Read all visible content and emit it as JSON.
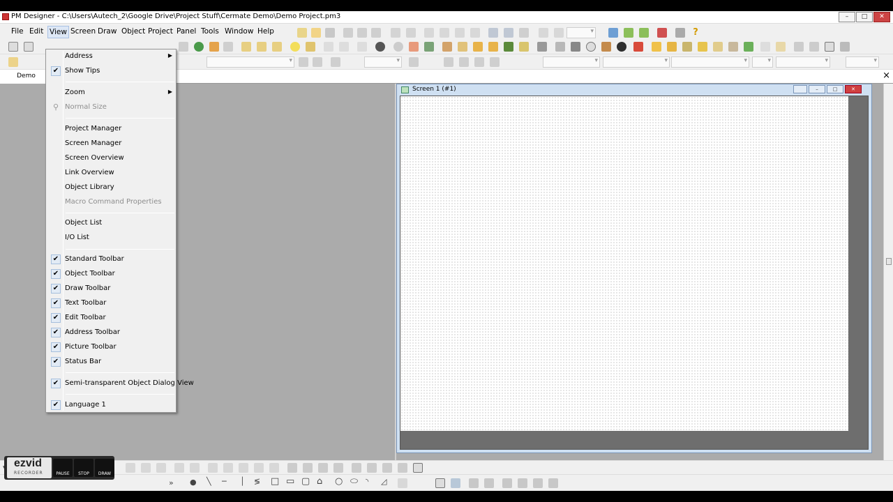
{
  "window": {
    "title": "PM Designer - C:\\Users\\Autech_2\\Google Drive\\Project Stuff\\Cermate Demo\\Demo Project.pm3",
    "min": "–",
    "max": "□",
    "close": "✕"
  },
  "menubar": {
    "items": [
      "File",
      "Edit",
      "View",
      "Screen",
      "Draw",
      "Object",
      "Project",
      "Panel",
      "Tools",
      "Window",
      "Help"
    ],
    "active_index": 2
  },
  "tabs": {
    "project_tab": "Demo",
    "close": "×"
  },
  "view_menu": {
    "items": [
      {
        "label": "Address",
        "submenu": true
      },
      {
        "label": "Show Tips",
        "checked": true
      },
      {
        "label": "Zoom",
        "submenu": true
      },
      {
        "label": "Normal Size",
        "disabled": true,
        "icon": "magnifier-icon"
      },
      {
        "label": "Project Manager"
      },
      {
        "label": "Screen Manager"
      },
      {
        "label": "Screen Overview"
      },
      {
        "label": "Link Overview"
      },
      {
        "label": "Object Library"
      },
      {
        "label": "Macro Command Properties",
        "disabled": true
      },
      {
        "label": "Object List"
      },
      {
        "label": "I/O List"
      },
      {
        "label": "Standard Toolbar",
        "checked": true
      },
      {
        "label": "Object Toolbar",
        "checked": true
      },
      {
        "label": "Draw Toolbar",
        "checked": true
      },
      {
        "label": "Text Toolbar",
        "checked": true
      },
      {
        "label": "Edit Toolbar",
        "checked": true
      },
      {
        "label": "Address Toolbar",
        "checked": true
      },
      {
        "label": "Picture Toolbar",
        "checked": true
      },
      {
        "label": "Status Bar",
        "checked": true
      },
      {
        "label": "Semi-transparent Object Dialog View",
        "checked": true
      },
      {
        "label": "Language 1",
        "checked": true
      }
    ],
    "check_glyph": "✔",
    "submenu_glyph": "▶"
  },
  "screen_window": {
    "title": "Screen 1 (#1)",
    "min": "–",
    "max": "□",
    "close": "✕"
  },
  "recorder": {
    "brand": "ezvid",
    "tagline": "RECORDER",
    "buttons": [
      "PAUSE",
      "STOP",
      "DRAW"
    ]
  },
  "colors": {
    "workspace": "#ababab",
    "menu_bg": "#f0f0f0",
    "checkmark_bg": "#e2ebf5"
  }
}
